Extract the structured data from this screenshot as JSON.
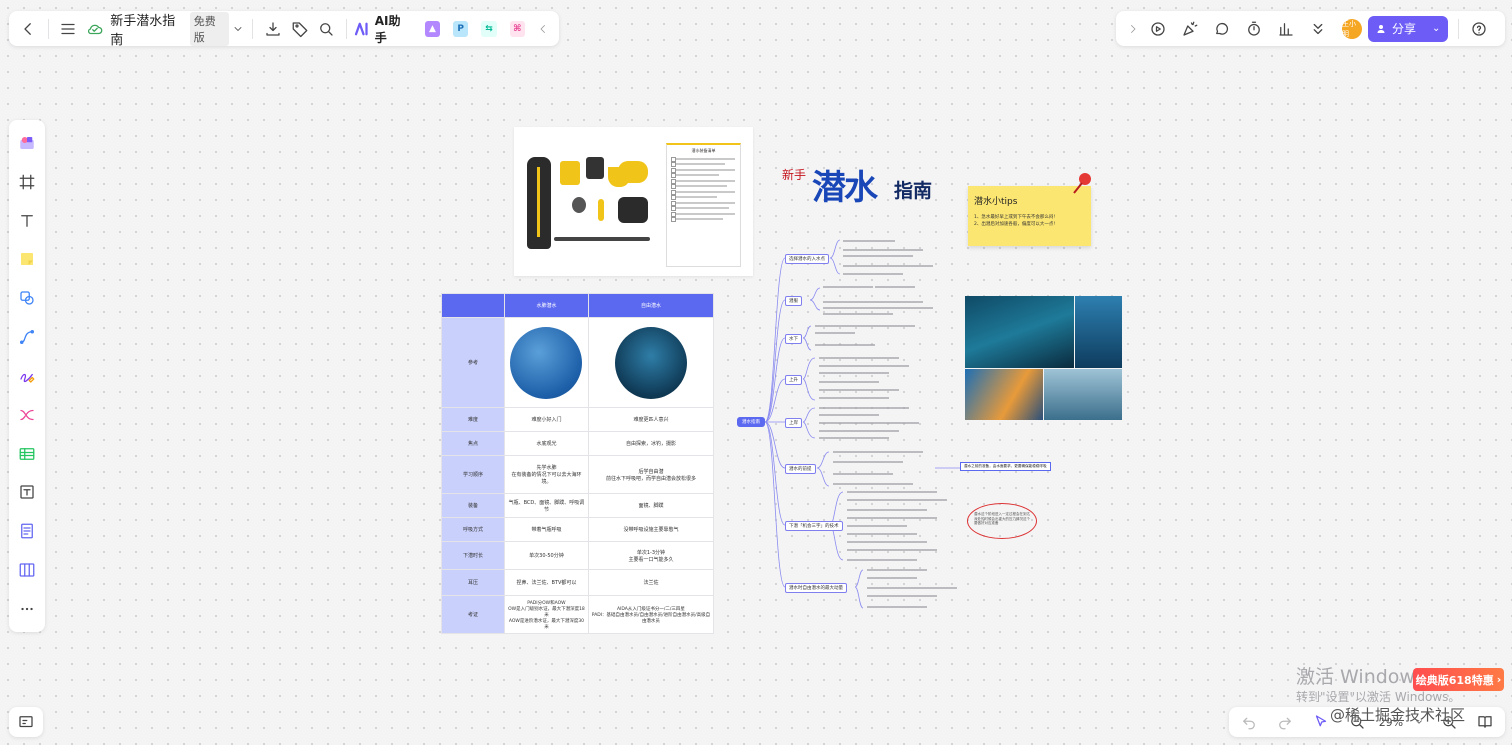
{
  "header": {
    "doc_title": "新手潜水指南",
    "plan_badge": "免费版",
    "ai_label": "AI助手",
    "plugin_p": "P"
  },
  "top_right": {
    "share_label": "分享",
    "avatar_text": "王小明"
  },
  "zoom": {
    "value": "29%"
  },
  "gear_card": {
    "checklist_title": "潜水装备清单"
  },
  "table": {
    "headers": [
      "",
      "水肺潜水",
      "自由潜水"
    ],
    "rows": [
      {
        "label": "参考",
        "a": "",
        "b": ""
      },
      {
        "label": "难度",
        "a": "难度小好入门",
        "b": "难度更匹人意兴"
      },
      {
        "label": "焦点",
        "a": "水底观光",
        "b": "自由探索，冰钓，摄影"
      },
      {
        "label": "学习顺序",
        "a": "先学水肺\n在有装备的情况下可以去大海环境。",
        "b": "后学自由潜\n前往水下呼吸吧，而学自由潜会放松很多"
      },
      {
        "label": "装备",
        "a": "气瓶、BCD、面镜、脚蹼、呼吸调节",
        "b": "面镜、脚蹼"
      },
      {
        "label": "呼吸方式",
        "a": "带着气瓶呼吸",
        "b": "没带呼吸设施主要靠憋气"
      },
      {
        "label": "下潜时长",
        "a": "单次30-50分钟",
        "b": "单次1-3分钟\n主要看一口气能多久"
      },
      {
        "label": "耳压",
        "a": "捏鼻、法兰佐、BTV都可以",
        "b": "法兰佐"
      },
      {
        "label": "考证",
        "a": "PADI分OW和AOW\nOW是入门级别水证，最大下潜深度18米\nAOW是进阶潜水证，最大下潜深度30米",
        "b": "AIDA从入门级证书分一/二/三四星\nPADI：基础自由潜水员/自由潜水员/进阶自由潜水员/高级自由潜水员"
      }
    ]
  },
  "title_art": {
    "small": "新手",
    "big": "潜水",
    "mid": "指南"
  },
  "sticky": {
    "title": "潜水小tips",
    "lines": [
      "1、急水最好早上或到下午去不会那么闷!",
      "2、出潜后对加速各般，偏度可以大一点!"
    ]
  },
  "mindmap": {
    "root": "潜水指南",
    "branches": [
      "选择潜水的入水点",
      "潜服",
      "水下",
      "上升",
      "上岸",
      "潜水的前提",
      "下潜「机会三字」的技术",
      "潜水时自由潜水的最大动量"
    ],
    "note": "潜水之前的准备，由水面要求，更要确保能稳稳呼吸",
    "circle_note": "潜水这个阶段进入一定过程会在到达深处的时候会出现大的压力情况这个要做好对应准备"
  },
  "watermark": {
    "line1": "激活 Windows",
    "line2": "转到\"设置\"以激活 Windows。",
    "promo": "绘典版618特惠",
    "juejin": "@稀土掘金技术社区"
  },
  "colors": {
    "accent": "#6d5cf6",
    "table_header": "#5b68f0",
    "sticky": "#fce672"
  }
}
